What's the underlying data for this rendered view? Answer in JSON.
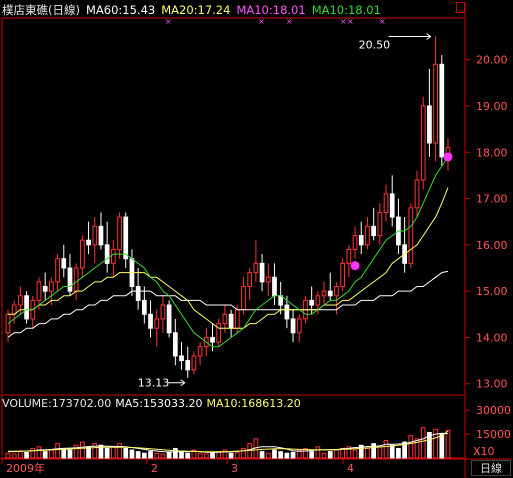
{
  "header": {
    "title": "樸店東礁(日線)",
    "ma60": "MA60:15.43",
    "ma20": "MA20:17.24",
    "ma10_magenta": "MA10:18.01",
    "ma10_green": "MA10:18.01"
  },
  "volume_header": {
    "label": "VOLUME:173702.00",
    "ma5": "MA5:153033.20",
    "ma10": "MA10:168613.20"
  },
  "annotations": {
    "high": "20.50",
    "low": "13.13"
  },
  "period_button": "日線",
  "colors": {
    "up": "#ff3333",
    "down": "#ffffff",
    "ma_fast": "#33dd33",
    "ma_mid": "#ffff66",
    "ma_slow": "#ffffff",
    "marker": "#ff33ff",
    "axis": "#cc0000"
  },
  "chart_data": [
    {
      "type": "candlestick",
      "x_labels": [
        "2009年",
        "2",
        "3",
        "4"
      ],
      "ylim": [
        12.8,
        20.9
      ],
      "yticks": [
        "20.00",
        "19.00",
        "18.00",
        "17.00",
        "16.00",
        "15.00",
        "14.00",
        "13.00"
      ],
      "ytick_values": [
        20,
        19,
        18,
        17,
        16,
        15,
        14,
        13
      ],
      "candles": [
        [
          14.1,
          14.6,
          13.9,
          14.5
        ],
        [
          14.5,
          14.8,
          14.3,
          14.7
        ],
        [
          14.7,
          15.1,
          14.5,
          14.9
        ],
        [
          14.9,
          15.0,
          14.3,
          14.4
        ],
        [
          14.4,
          14.9,
          14.2,
          14.8
        ],
        [
          14.8,
          15.3,
          14.6,
          15.2
        ],
        [
          15.1,
          15.4,
          14.8,
          15.0
        ],
        [
          15.0,
          15.3,
          14.7,
          15.2
        ],
        [
          15.2,
          15.8,
          15.0,
          15.7
        ],
        [
          15.7,
          16.0,
          15.3,
          15.5
        ],
        [
          15.5,
          15.8,
          14.9,
          15.0
        ],
        [
          15.0,
          15.6,
          14.8,
          15.5
        ],
        [
          15.5,
          16.2,
          15.3,
          16.1
        ],
        [
          16.1,
          16.5,
          15.8,
          16.0
        ],
        [
          16.0,
          16.6,
          15.6,
          16.4
        ],
        [
          16.4,
          16.7,
          15.9,
          16.0
        ],
        [
          16.0,
          16.5,
          15.4,
          15.6
        ],
        [
          15.6,
          16.1,
          15.3,
          15.9
        ],
        [
          15.9,
          16.7,
          15.7,
          16.6
        ],
        [
          16.6,
          16.7,
          15.5,
          15.7
        ],
        [
          15.7,
          15.9,
          14.9,
          15.1
        ],
        [
          15.1,
          15.5,
          14.6,
          14.8
        ],
        [
          14.8,
          15.1,
          14.3,
          14.5
        ],
        [
          14.5,
          14.8,
          14.0,
          14.2
        ],
        [
          14.2,
          14.6,
          13.8,
          14.4
        ],
        [
          14.4,
          14.9,
          14.1,
          14.7
        ],
        [
          14.7,
          14.8,
          14.0,
          14.1
        ],
        [
          14.1,
          14.4,
          13.4,
          13.6
        ],
        [
          13.6,
          13.9,
          13.3,
          13.5
        ],
        [
          13.5,
          13.8,
          13.13,
          13.3
        ],
        [
          13.3,
          13.7,
          13.2,
          13.6
        ],
        [
          13.6,
          13.9,
          13.4,
          13.8
        ],
        [
          13.8,
          14.2,
          13.6,
          14.0
        ],
        [
          14.0,
          14.3,
          13.7,
          13.9
        ],
        [
          13.9,
          14.4,
          13.8,
          14.3
        ],
        [
          14.3,
          14.7,
          14.1,
          14.5
        ],
        [
          14.5,
          14.6,
          14.0,
          14.2
        ],
        [
          14.2,
          14.7,
          14.1,
          14.6
        ],
        [
          14.6,
          15.3,
          14.5,
          15.1
        ],
        [
          15.1,
          15.5,
          14.8,
          15.4
        ],
        [
          15.4,
          16.1,
          15.2,
          15.6
        ],
        [
          15.6,
          15.8,
          15.0,
          15.2
        ],
        [
          15.2,
          15.6,
          14.9,
          15.3
        ],
        [
          15.3,
          15.6,
          14.7,
          14.9
        ],
        [
          14.9,
          15.2,
          14.5,
          14.7
        ],
        [
          14.7,
          14.9,
          14.2,
          14.4
        ],
        [
          14.4,
          14.6,
          13.9,
          14.1
        ],
        [
          14.1,
          14.5,
          13.9,
          14.4
        ],
        [
          14.4,
          14.9,
          14.3,
          14.8
        ],
        [
          14.8,
          15.1,
          14.5,
          14.7
        ],
        [
          14.7,
          15.0,
          14.5,
          14.9
        ],
        [
          14.9,
          15.2,
          14.7,
          15.0
        ],
        [
          15.0,
          15.4,
          14.8,
          14.9
        ],
        [
          14.9,
          15.2,
          14.5,
          15.1
        ],
        [
          15.1,
          15.7,
          15.0,
          15.6
        ],
        [
          15.6,
          16.0,
          15.3,
          15.9
        ],
        [
          15.9,
          16.4,
          15.7,
          16.2
        ],
        [
          16.2,
          16.5,
          15.8,
          16.0
        ],
        [
          16.0,
          16.6,
          15.9,
          16.4
        ],
        [
          16.4,
          16.8,
          16.1,
          16.2
        ],
        [
          16.2,
          16.9,
          16.0,
          16.7
        ],
        [
          16.7,
          17.3,
          16.5,
          17.1
        ],
        [
          17.1,
          17.5,
          16.4,
          16.6
        ],
        [
          16.6,
          17.0,
          15.8,
          16.0
        ],
        [
          16.0,
          16.6,
          15.4,
          15.6
        ],
        [
          15.6,
          16.9,
          15.5,
          16.8
        ],
        [
          16.8,
          17.6,
          16.6,
          17.4
        ],
        [
          17.4,
          19.2,
          17.2,
          19.0
        ],
        [
          19.0,
          19.8,
          17.9,
          18.2
        ],
        [
          18.2,
          20.5,
          17.8,
          19.9
        ],
        [
          19.9,
          20.1,
          17.7,
          17.9
        ],
        [
          17.9,
          18.3,
          17.6,
          18.1
        ]
      ],
      "ma_fast": [
        14.3,
        14.4,
        14.5,
        14.6,
        14.6,
        14.7,
        14.8,
        14.9,
        15.0,
        15.1,
        15.1,
        15.2,
        15.3,
        15.4,
        15.5,
        15.6,
        15.7,
        15.8,
        15.8,
        15.8,
        15.7,
        15.6,
        15.5,
        15.3,
        15.2,
        15.0,
        14.9,
        14.7,
        14.5,
        14.3,
        14.1,
        14.0,
        13.9,
        13.8,
        13.8,
        13.9,
        14.0,
        14.1,
        14.2,
        14.4,
        14.6,
        14.7,
        14.8,
        14.9,
        14.9,
        14.8,
        14.7,
        14.6,
        14.5,
        14.5,
        14.6,
        14.7,
        14.8,
        14.8,
        14.9,
        15.0,
        15.2,
        15.3,
        15.5,
        15.7,
        15.9,
        16.1,
        16.2,
        16.3,
        16.3,
        16.4,
        16.6,
        16.9,
        17.2,
        17.5,
        17.7,
        17.9
      ],
      "ma_mid": [
        14.5,
        14.5,
        14.6,
        14.6,
        14.6,
        14.7,
        14.7,
        14.8,
        14.8,
        14.9,
        14.9,
        15.0,
        15.0,
        15.1,
        15.2,
        15.2,
        15.3,
        15.3,
        15.4,
        15.4,
        15.4,
        15.4,
        15.4,
        15.3,
        15.3,
        15.2,
        15.1,
        15.0,
        14.9,
        14.8,
        14.6,
        14.5,
        14.4,
        14.3,
        14.2,
        14.2,
        14.2,
        14.2,
        14.2,
        14.3,
        14.3,
        14.4,
        14.5,
        14.5,
        14.6,
        14.6,
        14.6,
        14.6,
        14.6,
        14.6,
        14.6,
        14.7,
        14.7,
        14.7,
        14.8,
        14.8,
        14.9,
        15.0,
        15.1,
        15.2,
        15.3,
        15.4,
        15.6,
        15.7,
        15.8,
        15.9,
        16.0,
        16.2,
        16.4,
        16.6,
        16.9,
        17.24
      ],
      "ma_slow": [
        14.0,
        14.1,
        14.1,
        14.2,
        14.2,
        14.3,
        14.3,
        14.4,
        14.4,
        14.5,
        14.5,
        14.6,
        14.6,
        14.7,
        14.7,
        14.8,
        14.8,
        14.9,
        14.9,
        14.9,
        15.0,
        15.0,
        15.0,
        15.0,
        14.9,
        14.9,
        14.9,
        14.9,
        14.8,
        14.8,
        14.8,
        14.8,
        14.7,
        14.7,
        14.7,
        14.7,
        14.7,
        14.6,
        14.6,
        14.6,
        14.6,
        14.6,
        14.6,
        14.6,
        14.6,
        14.6,
        14.6,
        14.6,
        14.6,
        14.6,
        14.6,
        14.6,
        14.6,
        14.6,
        14.7,
        14.7,
        14.7,
        14.8,
        14.8,
        14.8,
        14.9,
        14.9,
        14.9,
        15.0,
        15.0,
        15.0,
        15.1,
        15.1,
        15.2,
        15.3,
        15.4,
        15.43
      ],
      "markers": [
        {
          "index": 56,
          "value": 15.55
        },
        {
          "index": 71,
          "value": 17.9
        }
      ],
      "high": {
        "index": 69,
        "value": 20.5
      },
      "low": {
        "index": 29,
        "value": 13.13
      }
    },
    {
      "type": "bar",
      "title": "VOLUME",
      "yticks": [
        "30000",
        "15000",
        "X10"
      ],
      "ytick_values": [
        30000,
        15000
      ],
      "ylim": [
        0,
        32000
      ],
      "values": [
        3000,
        2500,
        4000,
        3500,
        6000,
        7000,
        4000,
        5000,
        9000,
        6000,
        5000,
        8000,
        10000,
        7000,
        9000,
        8000,
        6000,
        7000,
        9000,
        6000,
        5000,
        4000,
        3000,
        4000,
        3000,
        2500,
        3500,
        6000,
        4000,
        3000,
        5000,
        3000,
        2500,
        3000,
        4000,
        5000,
        3000,
        3500,
        6000,
        9000,
        12000,
        4000,
        3000,
        5000,
        4000,
        3000,
        3500,
        5000,
        6000,
        4000,
        7000,
        3000,
        4000,
        5000,
        6000,
        7000,
        5000,
        8000,
        6000,
        9000,
        7000,
        11000,
        8000,
        6000,
        10000,
        14000,
        12000,
        19000,
        16000,
        18000,
        15000,
        17370
      ],
      "ma_fast": [
        4000,
        4000,
        4200,
        4400,
        4600,
        5000,
        5200,
        5400,
        5800,
        6000,
        6200,
        6400,
        6800,
        7200,
        7400,
        7500,
        7400,
        7300,
        7200,
        7000,
        6600,
        6000,
        5400,
        4800,
        4400,
        4000,
        3800,
        3800,
        3900,
        4000,
        4200,
        4000,
        3600,
        3500,
        3600,
        3800,
        3900,
        4200,
        4600,
        5200,
        6400,
        7000,
        7000,
        7000,
        6400,
        5600,
        4600,
        4200,
        4400,
        4700,
        5100,
        5200,
        5300,
        5300,
        5800,
        6000,
        6600,
        6800,
        7200,
        7400,
        7600,
        8600,
        8600,
        8800,
        9000,
        10000,
        11000,
        12000,
        14000,
        15000,
        15500,
        15303
      ],
      "ma_slow": [
        4200,
        4200,
        4300,
        4400,
        4500,
        4700,
        4900,
        5100,
        5300,
        5500,
        5700,
        5900,
        6100,
        6300,
        6500,
        6700,
        6800,
        6800,
        6800,
        6700,
        6600,
        6400,
        6100,
        5800,
        5500,
        5200,
        4900,
        4600,
        4400,
        4200,
        4100,
        4000,
        3900,
        3900,
        3900,
        4000,
        4100,
        4300,
        4500,
        4800,
        5100,
        5400,
        5600,
        5800,
        5900,
        5800,
        5600,
        5400,
        5300,
        5200,
        5100,
        5100,
        5100,
        5200,
        5400,
        5600,
        5800,
        6000,
        6300,
        6600,
        6900,
        7200,
        7600,
        8000,
        8500,
        9100,
        9800,
        10600,
        11500,
        12600,
        14000,
        16861
      ]
    }
  ]
}
